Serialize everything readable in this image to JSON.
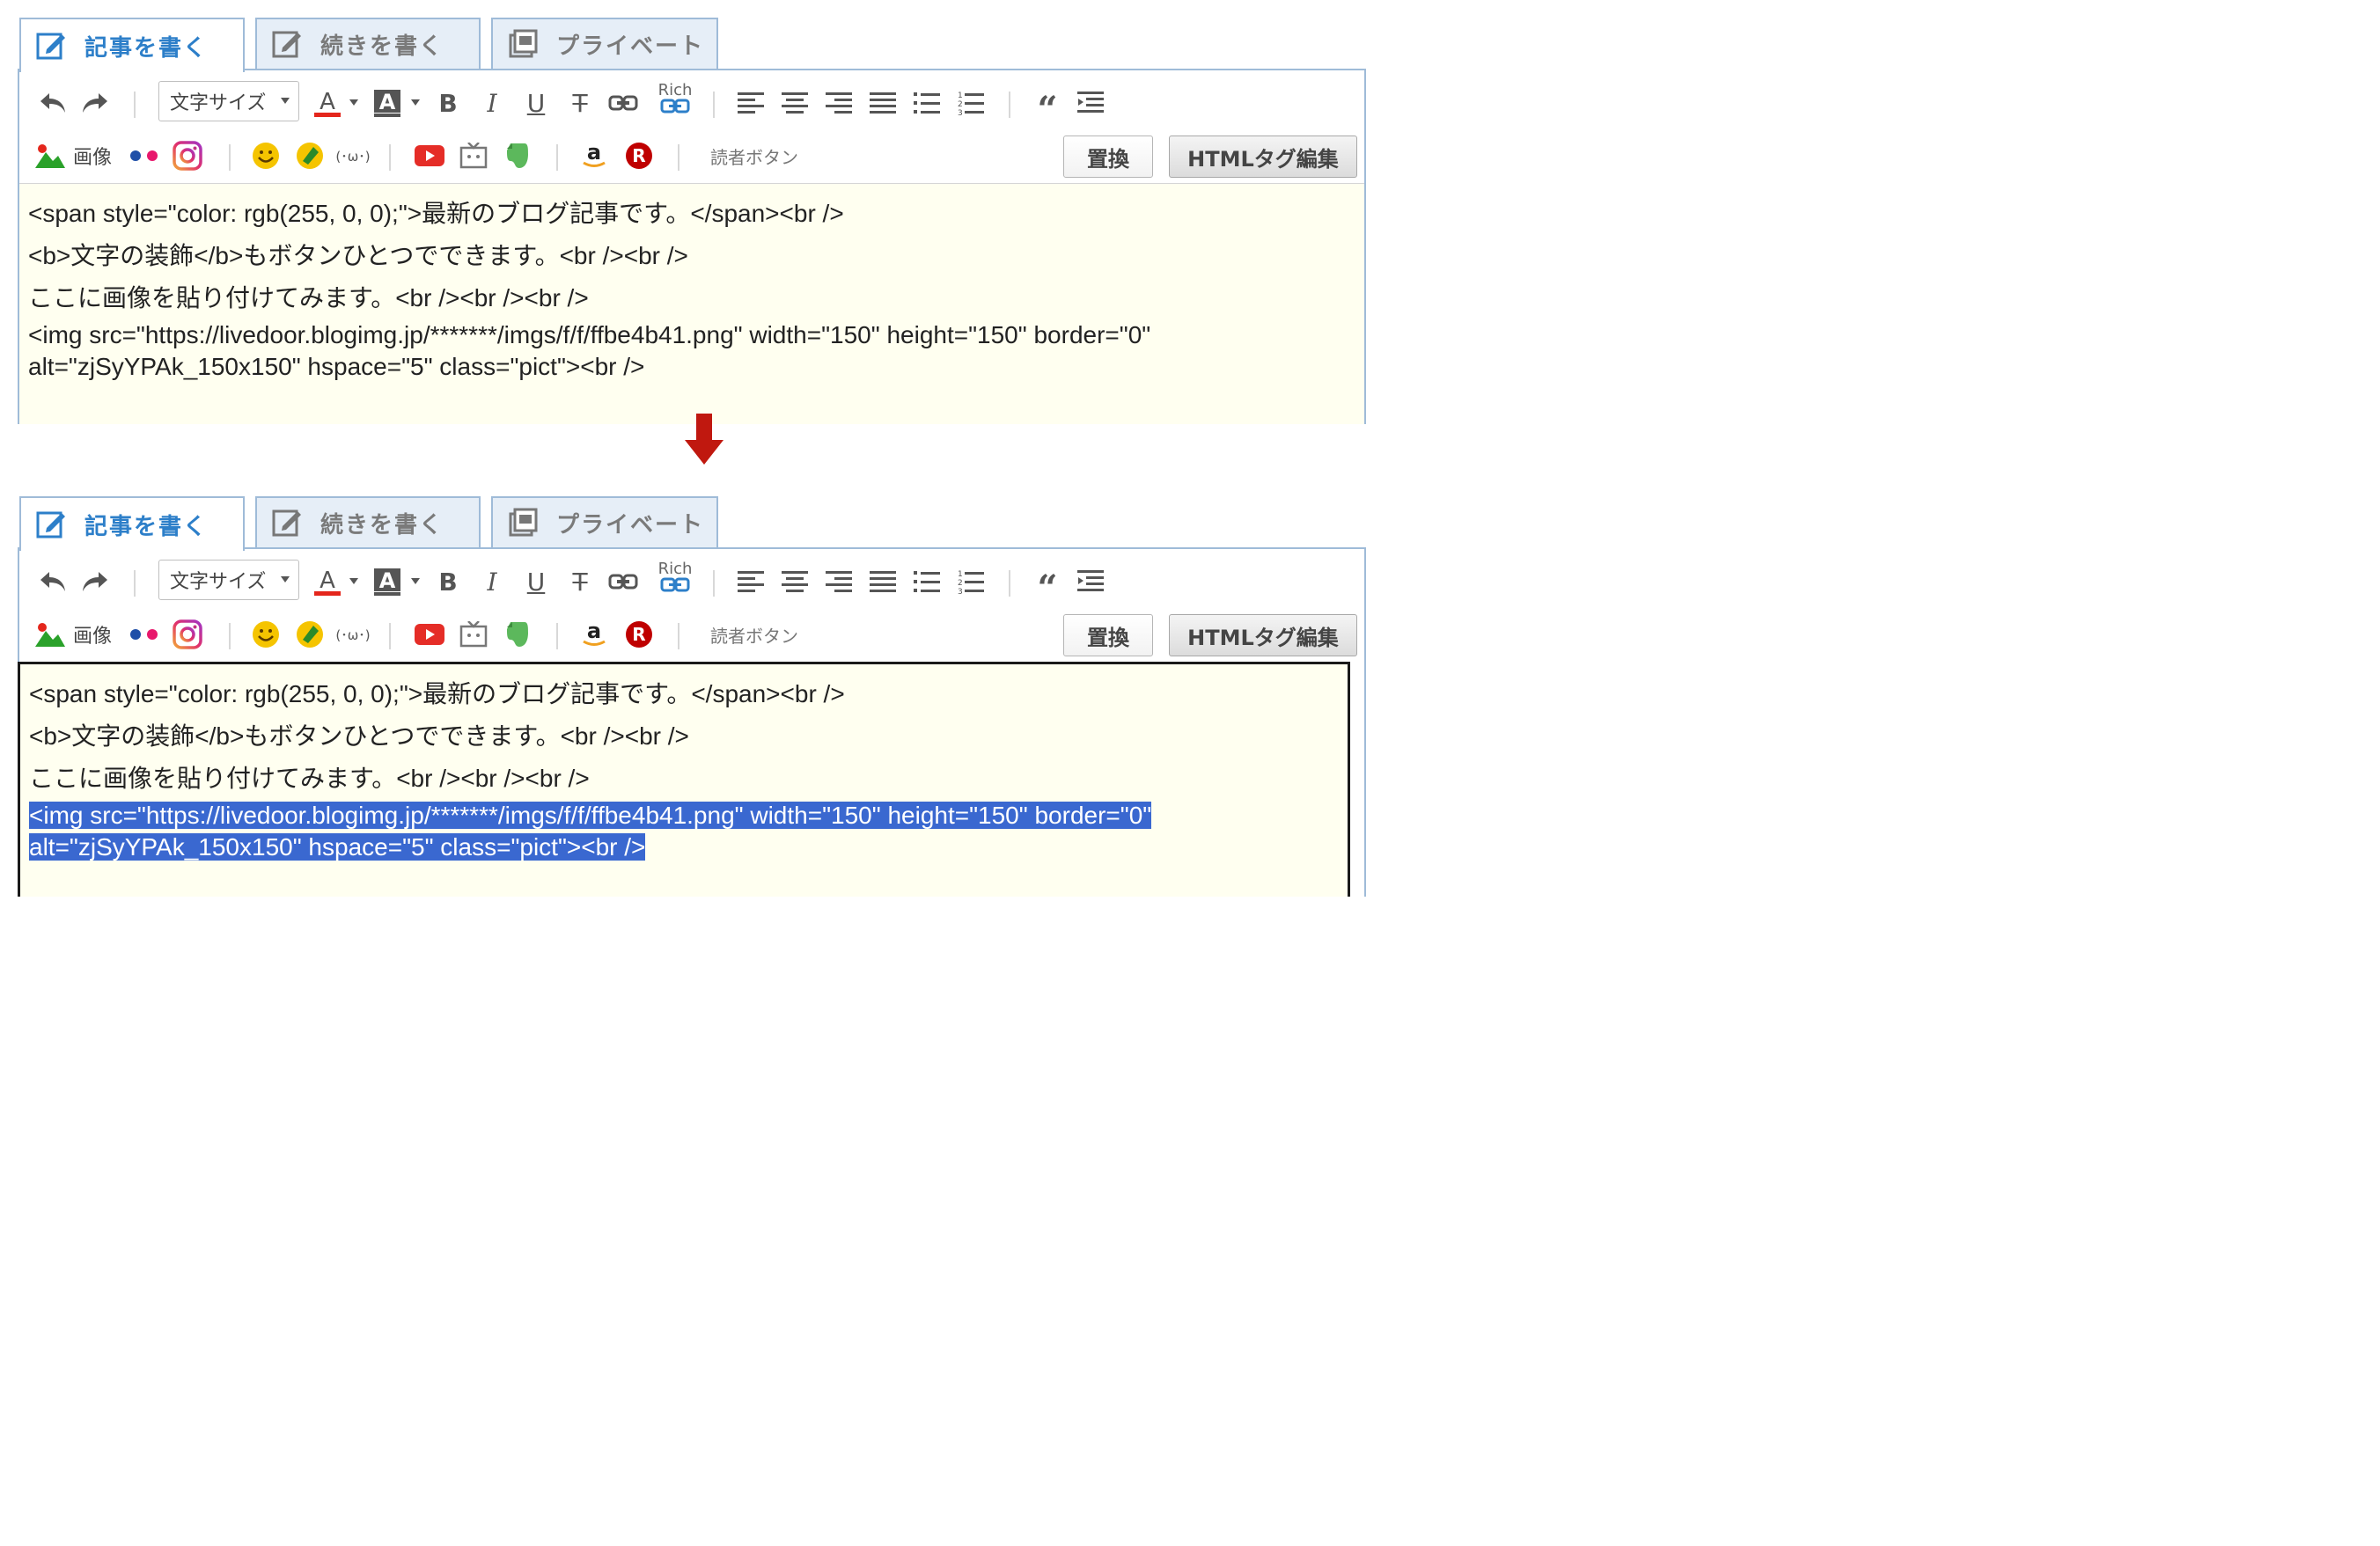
{
  "tabs": [
    {
      "label": "記事を書く",
      "active": true
    },
    {
      "label": "続きを書く",
      "active": false
    },
    {
      "label": "プライベート",
      "active": false
    }
  ],
  "toolbar": {
    "font_size_label": "文字サイズ",
    "rich_label": "Rich",
    "image_label": "画像",
    "kaomoji_label": "(･ω･)",
    "reader_button_label": "読者ボタン",
    "replace_label": "置換",
    "html_edit_label": "HTMLタグ編集"
  },
  "content": {
    "line1": "<span  style=\"color: rgb(255, 0, 0);\">最新のブログ記事です。</span><br />",
    "line2": "<b>文字の装飾</b>もボタンひとつでできます。<br /><br />",
    "line3": "ここに画像を貼り付けてみます。<br /><br /><br />",
    "line4": "<img  src=\"https://livedoor.blogimg.jp/*******/imgs/f/f/ffbe4b41.png\" width=\"150\" height=\"150\" border=\"0\"",
    "line5": "alt=\"zjSyYPAk_150x150\" hspace=\"5\" class=\"pict\"><br />"
  },
  "colors": {
    "accent": "#2d7fc9",
    "editor_bg": "#fffff0",
    "selection": "#3a68d0",
    "arrow": "#c0180f"
  }
}
